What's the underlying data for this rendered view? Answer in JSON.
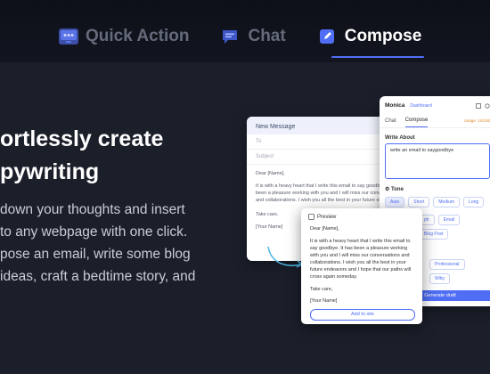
{
  "tabs": [
    {
      "label": "Quick Action",
      "icon": "monitor-icon",
      "active": false
    },
    {
      "label": "Chat",
      "icon": "chat-icon",
      "active": false
    },
    {
      "label": "Compose",
      "icon": "compose-icon",
      "active": true
    }
  ],
  "hero": {
    "line1": "ortlessly create",
    "line2": "pywriting"
  },
  "description": [
    "down your thoughts and insert",
    "to any webpage with one click.",
    "pose an email, write some blog",
    "ideas, craft a bedtime story, and"
  ],
  "email": {
    "title": "New Message",
    "to": "To",
    "subject": "Subject",
    "greeting": "Dear [Name],",
    "body": "It is with a heavy heart that I write this email to say goodbye. It has been a pleasure working with you and I will miss our conversations and collaborations. I wish you all the best in your future endeavors",
    "closing": "Take care,",
    "signature": "[Your Name]"
  },
  "panel": {
    "brand": "Monica",
    "dashboard": "Dashboard",
    "tab_chat": "Chat",
    "tab_compose": "Compose",
    "usage": "Usage: 10/100",
    "write_about_label": "Write About",
    "write_about_value": "write an email to saygoodbye",
    "tone_label": "Tone",
    "tone_options": [
      "Auto",
      "Short",
      "Medium",
      "Long"
    ],
    "format_options": [
      "ph",
      "Email",
      "Blog Post"
    ],
    "style_options": [
      "Professional",
      "Witty"
    ],
    "generate_label": "Generate draft"
  },
  "preview": {
    "title": "Preview",
    "greeting": "Dear [Name],",
    "body": "It is with a heavy heart that I write this email to say goodbye. It has been a pleasure working with you and I will miss our conversations and collaborations. I wish you all the best in your future endeavors and I hope that our paths will cross again someday.",
    "closing": "Take care,",
    "signature": "[Your Name]",
    "add_button": "Add to site"
  },
  "colors": {
    "accent": "#4f6ef5",
    "background": "#1b1f2a"
  }
}
